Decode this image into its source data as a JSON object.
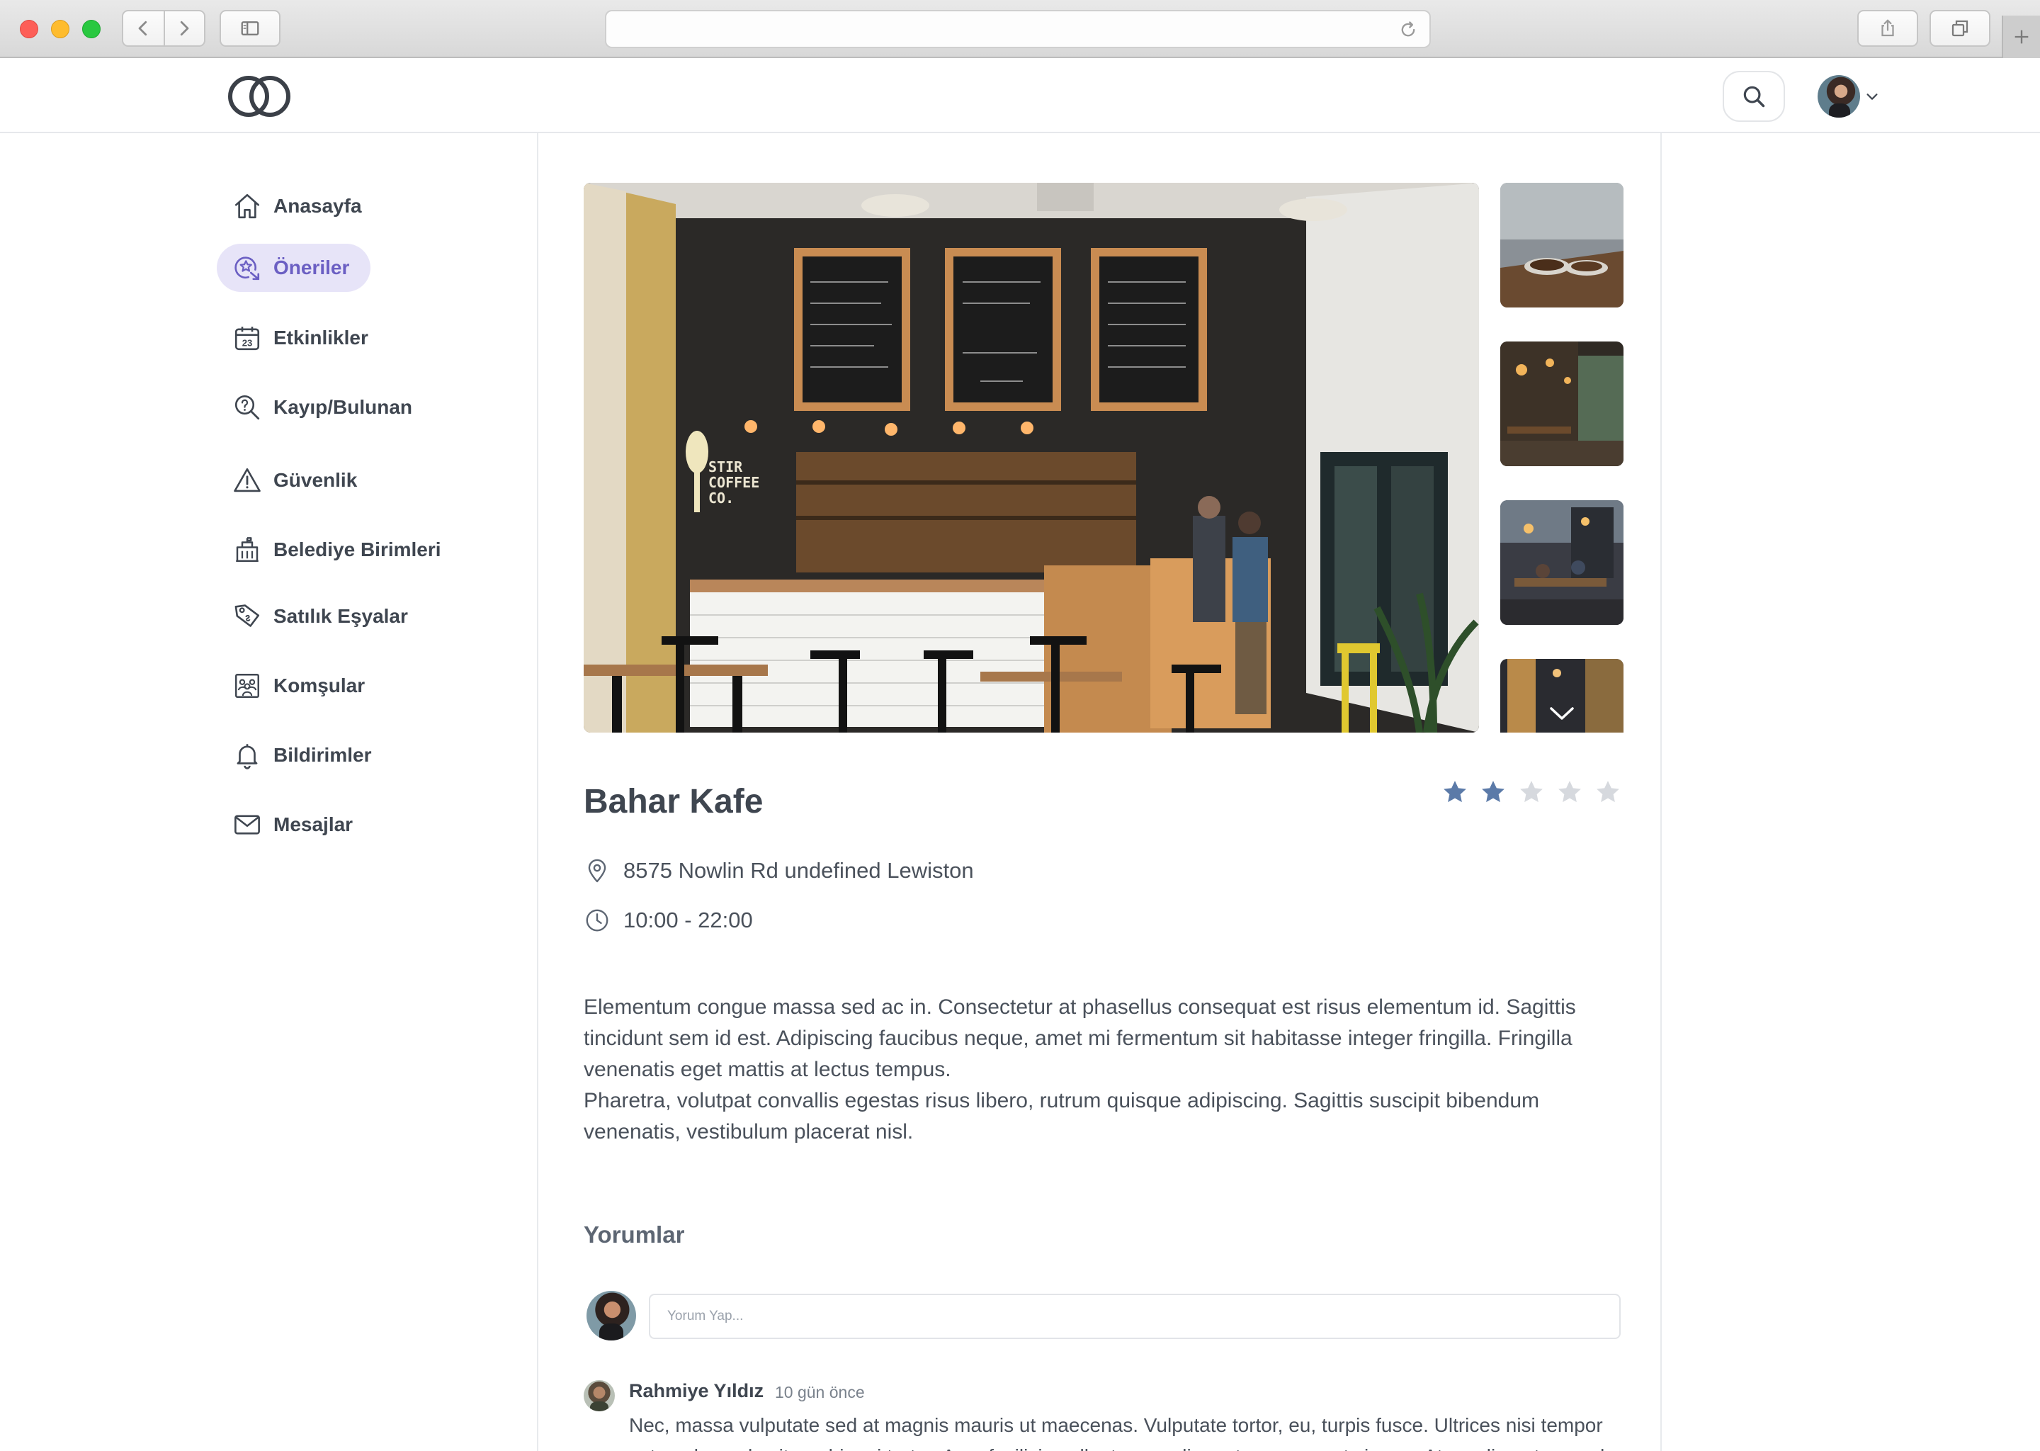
{
  "browser": {
    "url": ""
  },
  "header": {
    "logo": "interlocking-rings-logo",
    "search_icon": "search-icon"
  },
  "sidebar": {
    "items": [
      {
        "label": "Anasayfa",
        "icon": "home-icon",
        "active": false
      },
      {
        "label": "Öneriler",
        "icon": "star-badge-icon",
        "active": true
      },
      {
        "label": "Etkinlikler",
        "icon": "calendar-icon",
        "active": false
      },
      {
        "label": "Kayıp/Bulunan",
        "icon": "magnifier-question-icon",
        "active": false
      },
      {
        "label": "Güvenlik",
        "icon": "warning-icon",
        "active": false
      },
      {
        "label": "Belediye Birimleri",
        "icon": "municipal-building-icon",
        "active": false
      },
      {
        "label": "Satılık Eşyalar",
        "icon": "price-tag-icon",
        "active": false
      },
      {
        "label": "Komşular",
        "icon": "neighbors-icon",
        "active": false
      },
      {
        "label": "Bildirimler",
        "icon": "bell-icon",
        "active": false
      },
      {
        "label": "Mesajlar",
        "icon": "envelope-icon",
        "active": false
      }
    ]
  },
  "place": {
    "name": "Bahar Kafe",
    "rating": 2,
    "rating_max": 5,
    "address": "8575 Nowlin Rd undefined Lewiston",
    "hours": "10:00 - 22:00",
    "description": [
      "Elementum congue massa sed ac in. Consectetur at phasellus consequat est risus elementum id. Sagittis tincidunt sem id est. Adipiscing faucibus neque, amet mi fermentum sit habitasse integer fringilla. Fringilla venenatis eget mattis at lectus tempus.",
      "Pharetra, volutpat convallis egestas risus libero, rutrum quisque adipiscing. Sagittis suscipit bibendum venenatis, vestibulum placerat nisl."
    ]
  },
  "colors": {
    "accent": "#6b5fc3",
    "active_bg": "#e7e4f8",
    "star_filled": "#5b7aa8",
    "star_empty": "#d6d9de"
  },
  "comments": {
    "title": "Yorumlar",
    "input_placeholder": "Yorum Yap...",
    "items": [
      {
        "author": "Rahmiye Yıldız",
        "time": "10 gün önce",
        "text": "Nec, massa vulputate sed at magnis mauris ut maecenas. Vulputate tortor, eu, turpis fusce. Ultrices nisi tempor est, malesuada sit morbi orci tortor. Arcu facilisis pellentesque diam at massa eget viverra. At condimentum sed"
      }
    ]
  }
}
